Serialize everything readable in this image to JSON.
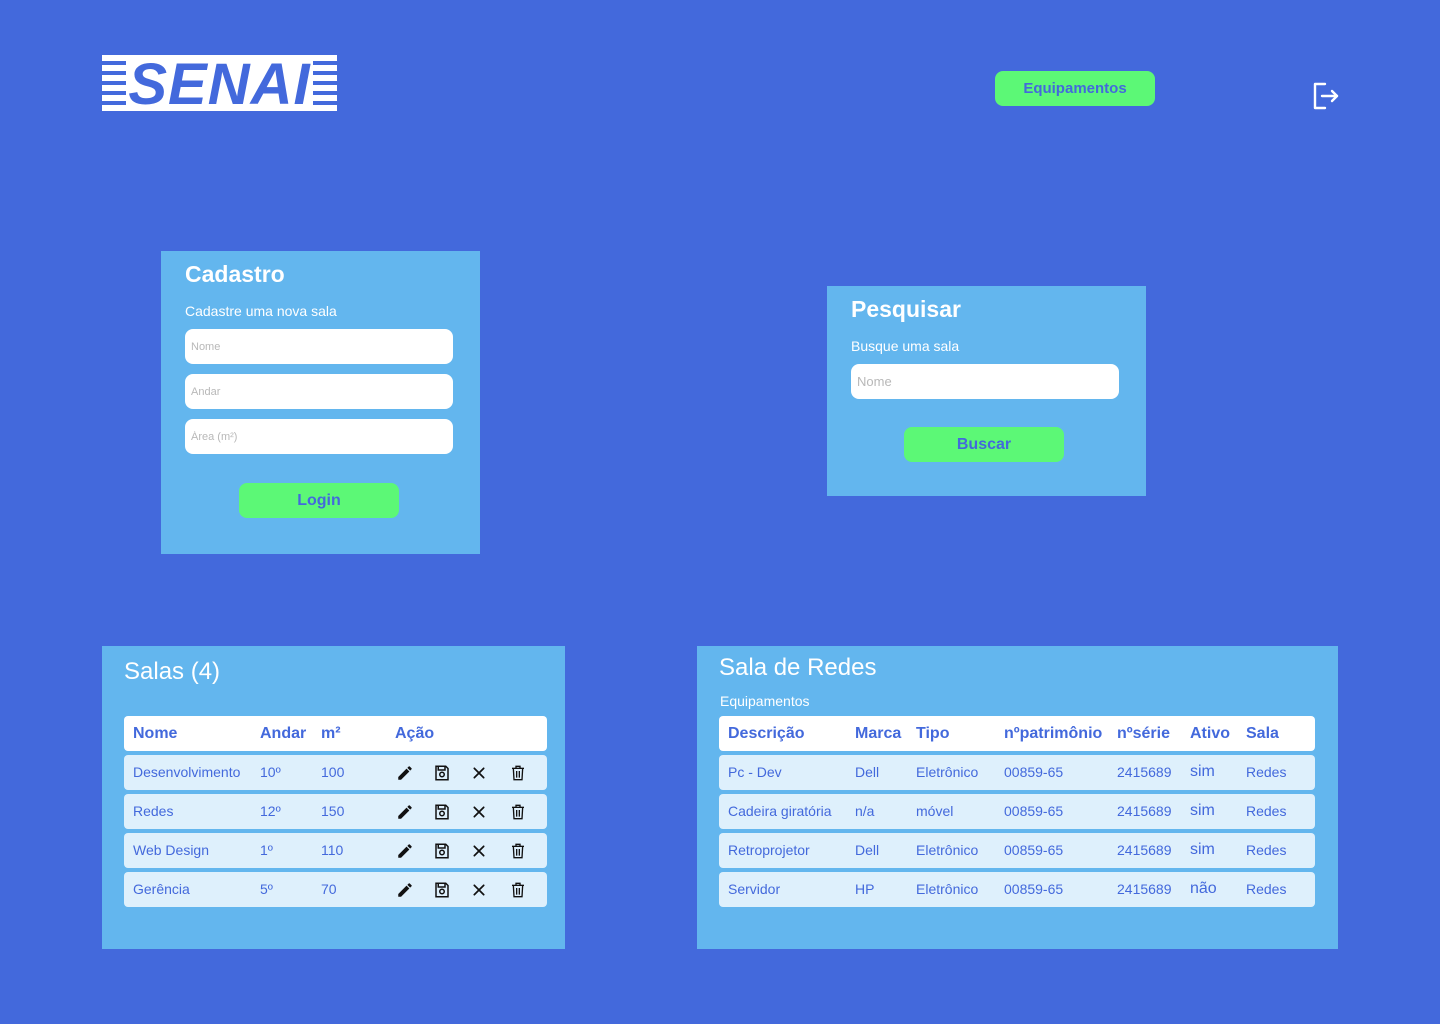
{
  "header": {
    "logo_text": "SENAI",
    "nav_button_label": "Equipamentos",
    "logout_icon": "logout-icon"
  },
  "cadastro": {
    "title": "Cadastro",
    "subtitle": "Cadastre uma nova sala",
    "fields": {
      "nome_placeholder": "Nome",
      "andar_placeholder": "Andar",
      "area_placeholder": "Área (m²)"
    },
    "submit_label": "Login"
  },
  "pesquisar": {
    "title": "Pesquisar",
    "subtitle": "Busque uma sala",
    "search_placeholder": "Nome",
    "submit_label": "Buscar"
  },
  "salas": {
    "title": "Salas (4)",
    "columns": [
      "Nome",
      "Andar",
      "m²",
      "Ação"
    ],
    "rows": [
      {
        "nome": "Desenvolvimento",
        "andar": "10º",
        "area": "100"
      },
      {
        "nome": "Redes",
        "andar": "12º",
        "area": "150"
      },
      {
        "nome": "Web Design",
        "andar": "1º",
        "area": "110"
      },
      {
        "nome": "Gerência",
        "andar": "5º",
        "area": "70"
      }
    ],
    "actions": [
      "pencil-icon",
      "save-icon",
      "close-icon",
      "trash-icon"
    ]
  },
  "sala_redes": {
    "title": "Sala de Redes",
    "subtitle": "Equipamentos",
    "columns": [
      "Descrição",
      "Marca",
      "Tipo",
      "nºpatrimônio",
      "nºsérie",
      "Ativo",
      "Sala"
    ],
    "rows": [
      {
        "descricao": "Pc - Dev",
        "marca": "Dell",
        "tipo": "Eletrônico",
        "patrimonio": "00859-65",
        "serie": "2415689",
        "ativo": "sim",
        "sala": "Redes"
      },
      {
        "descricao": "Cadeira giratória",
        "marca": "n/a",
        "tipo": "móvel",
        "patrimonio": "00859-65",
        "serie": "2415689",
        "ativo": "sim",
        "sala": "Redes"
      },
      {
        "descricao": "Retroprojetor",
        "marca": "Dell",
        "tipo": "Eletrônico",
        "patrimonio": "00859-65",
        "serie": "2415689",
        "ativo": "sim",
        "sala": "Redes"
      },
      {
        "descricao": "Servidor",
        "marca": "HP",
        "tipo": "Eletrônico",
        "patrimonio": "00859-65",
        "serie": "2415689",
        "ativo": "não",
        "sala": "Redes"
      }
    ]
  },
  "colors": {
    "background": "#4369dc",
    "card": "#63b6ee",
    "accent_green": "#5cf876",
    "row": "#def0fc"
  }
}
